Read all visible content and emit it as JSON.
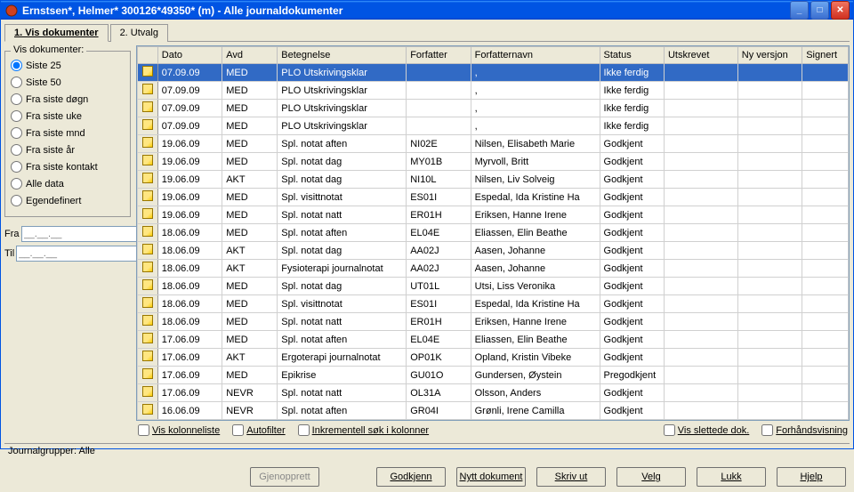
{
  "window": {
    "title": "Ernstsen*, Helmer*  300126*49350* (m) - Alle journaldokumenter"
  },
  "tabs": {
    "t1_label": "1. Vis dokumenter",
    "t2_label": "2. Utvalg"
  },
  "sidebar": {
    "group_title": "Vis dokumenter:",
    "opts": {
      "siste25": "Siste 25",
      "siste50": "Siste 50",
      "fra_dogn": "Fra siste døgn",
      "fra_uke": "Fra siste uke",
      "fra_mnd": "Fra siste mnd",
      "fra_ar": "Fra siste år",
      "fra_kontakt": "Fra siste kontakt",
      "alle": "Alle data",
      "egen": "Egendefinert"
    },
    "fra_label": "Fra",
    "til_label": "Til",
    "date_placeholder": "__.__.__"
  },
  "columns": {
    "dato": "Dato",
    "avd": "Avd",
    "bet": "Betegnelse",
    "forf": "Forfatter",
    "nav": "Forfatternavn",
    "stat": "Status",
    "uts": "Utskrevet",
    "nyv": "Ny versjon",
    "sig": "Signert"
  },
  "rows": [
    {
      "dato": "07.09.09",
      "avd": "MED",
      "bet": "PLO Utskrivingsklar",
      "forf": "",
      "nav": ",",
      "stat": "Ikke ferdig",
      "uts": "",
      "nyv": "",
      "sig": ""
    },
    {
      "dato": "07.09.09",
      "avd": "MED",
      "bet": "PLO Utskrivingsklar",
      "forf": "",
      "nav": ",",
      "stat": "Ikke ferdig",
      "uts": "",
      "nyv": "",
      "sig": ""
    },
    {
      "dato": "07.09.09",
      "avd": "MED",
      "bet": "PLO Utskrivingsklar",
      "forf": "",
      "nav": ",",
      "stat": "Ikke ferdig",
      "uts": "",
      "nyv": "",
      "sig": ""
    },
    {
      "dato": "07.09.09",
      "avd": "MED",
      "bet": "PLO Utskrivingsklar",
      "forf": "",
      "nav": ",",
      "stat": "Ikke ferdig",
      "uts": "",
      "nyv": "",
      "sig": ""
    },
    {
      "dato": "19.06.09",
      "avd": "MED",
      "bet": "Spl. notat aften",
      "forf": "NI02E",
      "nav": "Nilsen, Elisabeth Marie",
      "stat": "Godkjent",
      "uts": "",
      "nyv": "",
      "sig": ""
    },
    {
      "dato": "19.06.09",
      "avd": "MED",
      "bet": "Spl. notat dag",
      "forf": "MY01B",
      "nav": "Myrvoll, Britt",
      "stat": "Godkjent",
      "uts": "",
      "nyv": "",
      "sig": ""
    },
    {
      "dato": "19.06.09",
      "avd": "AKT",
      "bet": "Spl. notat dag",
      "forf": "NI10L",
      "nav": "Nilsen, Liv Solveig",
      "stat": "Godkjent",
      "uts": "",
      "nyv": "",
      "sig": ""
    },
    {
      "dato": "19.06.09",
      "avd": "MED",
      "bet": "Spl. visittnotat",
      "forf": "ES01I",
      "nav": "Espedal, Ida Kristine Ha",
      "stat": "Godkjent",
      "uts": "",
      "nyv": "",
      "sig": ""
    },
    {
      "dato": "19.06.09",
      "avd": "MED",
      "bet": "Spl. notat natt",
      "forf": "ER01H",
      "nav": "Eriksen, Hanne Irene",
      "stat": "Godkjent",
      "uts": "",
      "nyv": "",
      "sig": ""
    },
    {
      "dato": "18.06.09",
      "avd": "MED",
      "bet": "Spl. notat aften",
      "forf": "EL04E",
      "nav": "Eliassen, Elin Beathe",
      "stat": "Godkjent",
      "uts": "",
      "nyv": "",
      "sig": ""
    },
    {
      "dato": "18.06.09",
      "avd": "AKT",
      "bet": "Spl. notat dag",
      "forf": "AA02J",
      "nav": "Aasen, Johanne",
      "stat": "Godkjent",
      "uts": "",
      "nyv": "",
      "sig": ""
    },
    {
      "dato": "18.06.09",
      "avd": "AKT",
      "bet": "Fysioterapi journalnotat",
      "forf": "AA02J",
      "nav": "Aasen, Johanne",
      "stat": "Godkjent",
      "uts": "",
      "nyv": "",
      "sig": ""
    },
    {
      "dato": "18.06.09",
      "avd": "MED",
      "bet": "Spl. notat dag",
      "forf": "UT01L",
      "nav": "Utsi, Liss Veronika",
      "stat": "Godkjent",
      "uts": "",
      "nyv": "",
      "sig": ""
    },
    {
      "dato": "18.06.09",
      "avd": "MED",
      "bet": "Spl. visittnotat",
      "forf": "ES01I",
      "nav": "Espedal, Ida Kristine Ha",
      "stat": "Godkjent",
      "uts": "",
      "nyv": "",
      "sig": ""
    },
    {
      "dato": "18.06.09",
      "avd": "MED",
      "bet": "Spl. notat natt",
      "forf": "ER01H",
      "nav": "Eriksen, Hanne Irene",
      "stat": "Godkjent",
      "uts": "",
      "nyv": "",
      "sig": ""
    },
    {
      "dato": "17.06.09",
      "avd": "MED",
      "bet": "Spl. notat aften",
      "forf": "EL04E",
      "nav": "Eliassen, Elin Beathe",
      "stat": "Godkjent",
      "uts": "",
      "nyv": "",
      "sig": ""
    },
    {
      "dato": "17.06.09",
      "avd": "AKT",
      "bet": "Ergoterapi journalnotat",
      "forf": "OP01K",
      "nav": "Opland, Kristin Vibeke",
      "stat": "Godkjent",
      "uts": "",
      "nyv": "",
      "sig": ""
    },
    {
      "dato": "17.06.09",
      "avd": "MED",
      "bet": "Epikrise",
      "forf": "GU01O",
      "nav": "Gundersen, Øystein",
      "stat": "Pregodkjent",
      "uts": "",
      "nyv": "",
      "sig": ""
    },
    {
      "dato": "17.06.09",
      "avd": "NEVR",
      "bet": "Spl. notat natt",
      "forf": "OL31A",
      "nav": "Olsson, Anders",
      "stat": "Godkjent",
      "uts": "",
      "nyv": "",
      "sig": ""
    },
    {
      "dato": "16.06.09",
      "avd": "NEVR",
      "bet": "Spl. notat aften",
      "forf": "GR04I",
      "nav": "Grønli, Irene Camilla",
      "stat": "Godkjent",
      "uts": "",
      "nyv": "",
      "sig": ""
    }
  ],
  "checks": {
    "kolonneliste": "Vis kolonneliste",
    "autofilter": "Autofilter",
    "inkrementell": "Inkrementell søk i kolonner",
    "slettede": "Vis slettede dok.",
    "forhand": "Forhåndsvisning"
  },
  "status": {
    "grupper_label": "Journalgrupper:",
    "grupper_value": "Alle"
  },
  "buttons": {
    "gjenopprett": "Gjenopprett",
    "godkjenn": "Godkjenn",
    "nytt": "Nytt dokument",
    "skriv": "Skriv ut",
    "velg": "Velg",
    "lukk": "Lukk",
    "hjelp": "Hjelp"
  }
}
